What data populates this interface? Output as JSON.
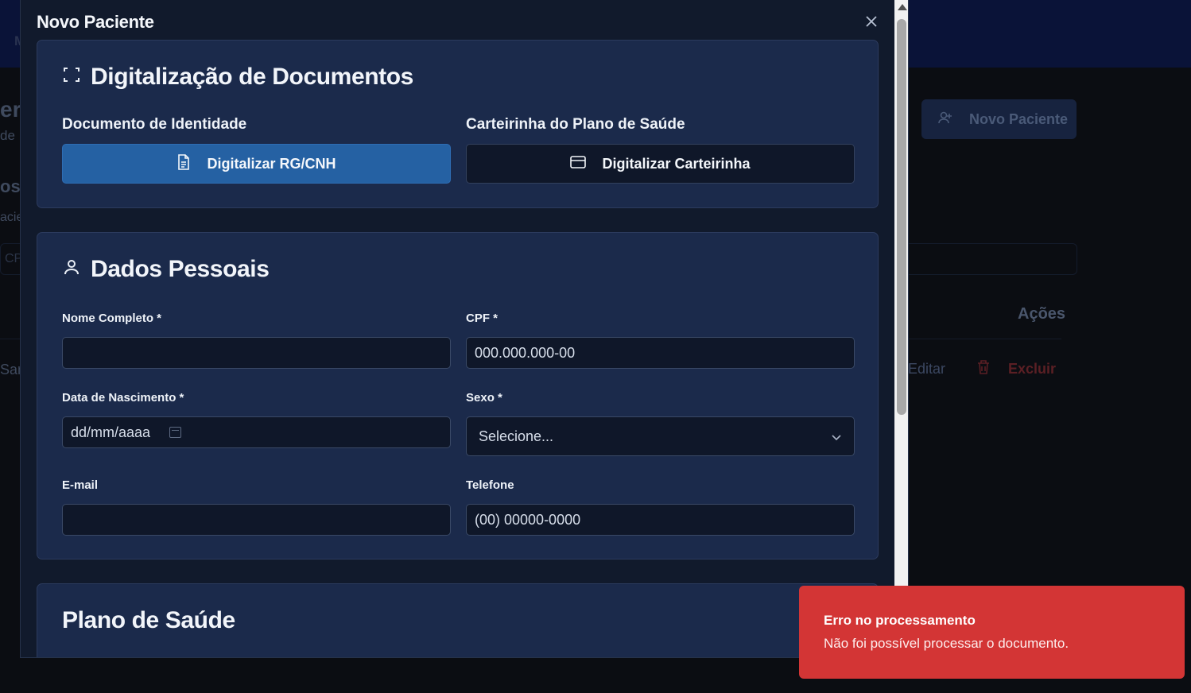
{
  "background": {
    "new_patient_button": "Novo Paciente",
    "col_actions": "Ações",
    "row_edit": "Editar",
    "row_delete": "Excluir",
    "fragments": [
      "M",
      "er",
      "de",
      "os",
      "acie",
      "CP",
      "Sar"
    ]
  },
  "modal": {
    "title": "Novo Paciente",
    "documents": {
      "title": "Digitalização de Documentos",
      "id_label": "Documento de Identidade",
      "id_button": "Digitalizar RG/CNH",
      "card_label": "Carteirinha do Plano de Saúde",
      "card_button": "Digitalizar Carteirinha"
    },
    "personal": {
      "title": "Dados Pessoais",
      "name_label": "Nome Completo *",
      "name_value": "",
      "cpf_label": "CPF *",
      "cpf_placeholder": "000.000.000-00",
      "birth_label": "Data de Nascimento *",
      "birth_placeholder": "dd/mm/aaaa",
      "sex_label": "Sexo *",
      "sex_selected": "Selecione...",
      "email_label": "E-mail",
      "email_value": "",
      "phone_label": "Telefone",
      "phone_placeholder": "(00) 00000-0000"
    },
    "health_plan": {
      "title": "Plano de Saúde"
    }
  },
  "toast": {
    "title": "Erro no processamento",
    "message": "Não foi possível processar o documento."
  },
  "colors": {
    "primary_button": "#2561a3",
    "card_bg": "#1b2a4b",
    "toast_bg": "#d33535"
  }
}
